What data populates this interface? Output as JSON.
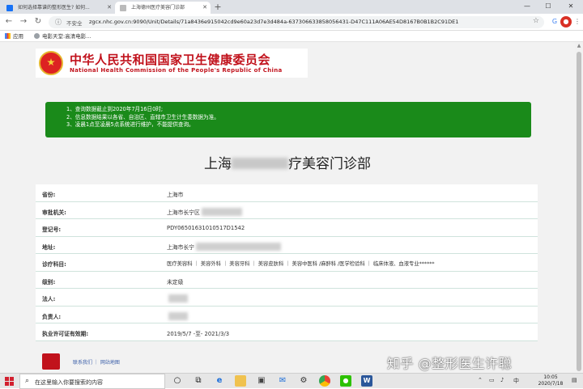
{
  "browser": {
    "tabs": [
      {
        "label": "如何选择靠谱的整形医生? 如何..."
      },
      {
        "label": "上海德州医疗美容门诊部"
      }
    ],
    "new_tab": "+",
    "security_label": "不安全",
    "url": "zgcx.nhc.gov.cn:9090/Unit/Details/71a8436e915042cd9e60a23d7e3d484a-637306633858056431-D47C111A06AE54D8167B0B1B2C91DE1",
    "bookmarks": [
      {
        "label": "应用"
      },
      {
        "label": "电影天堂:高清电影..."
      }
    ]
  },
  "header": {
    "ministry_cn": "中华人民共和国国家卫生健康委员会",
    "ministry_en": "National Health Commission of the People's Republic of China"
  },
  "notice": {
    "lines": [
      "1、查询数据截止到2020年7月16日0时;",
      "2、信息数据结果以各省、自治区、直辖市卫生计生委数据为准。",
      "3、凌晨1点至凌晨5点系统进行维护，不能提供查询。"
    ]
  },
  "unit": {
    "title_prefix": "上海",
    "title_suffix": "疗美容门诊部"
  },
  "details": [
    {
      "label": "省份:",
      "value": "上海市"
    },
    {
      "label": "审批机关:",
      "value": "上海市长宁区"
    },
    {
      "label": "登记号:",
      "value": "PDY06501631010517D1542"
    },
    {
      "label": "地址:",
      "value": "上海市长宁"
    },
    {
      "label": "诊疗科目:",
      "value": "医疗美容科 ｜ 美容外科 ｜ 美容牙科 ｜ 美容皮肤科 ｜ 美容中医科 /麻醉科 /医学检验科 ｜ 临床体液、血液专业******"
    },
    {
      "label": "级别:",
      "value": "未定级"
    },
    {
      "label": "法人:",
      "value": ""
    },
    {
      "label": "负责人:",
      "value": ""
    },
    {
      "label": "执业许可证有效期:",
      "value": "2019/5/7  -至-  2021/3/3"
    }
  ],
  "footer": {
    "links": "联系我们 ｜ 网站地图"
  },
  "watermark": "知乎 @整形医生许聪",
  "taskbar": {
    "search_placeholder": "在这里输入你要搜索的内容",
    "time": "10:05",
    "date": "2020/7/18"
  }
}
